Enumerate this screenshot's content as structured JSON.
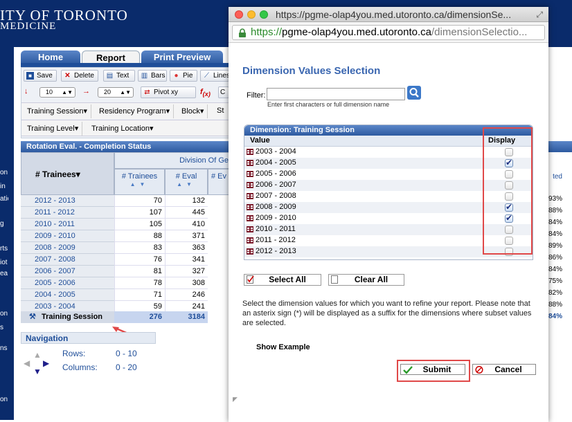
{
  "bg": {
    "uni_title": "ITY OF TORONTO",
    "uni_sub": "MEDICINE",
    "tabs": [
      {
        "label": "Home"
      },
      {
        "label": "Report"
      },
      {
        "label": "Print Preview"
      }
    ],
    "toolbar": {
      "save": "Save",
      "delete": "Delete",
      "text": "Text",
      "bars": "Bars",
      "pie": "Pie",
      "lines": "Lines",
      "rows_value": "10",
      "cols_value": "20",
      "pivot": "Pivot xy"
    },
    "dimensions": {
      "row1": [
        "Training Session",
        "Residency Program",
        "Block",
        "St"
      ],
      "row2": [
        "Training Level",
        "Training Location"
      ]
    },
    "grid": {
      "title": "Rotation Eval. - Completion Status",
      "row_header": "# Trainees",
      "division_header": "Division Of Ge",
      "col_trainees": "# Trainees",
      "col_eval": "# Eval",
      "col_ev": "# Ev",
      "rows": [
        {
          "label": "2012 - 2013",
          "trainees": "70",
          "eval": "132"
        },
        {
          "label": "2011 - 2012",
          "trainees": "107",
          "eval": "445"
        },
        {
          "label": "2010 - 2011",
          "trainees": "105",
          "eval": "410"
        },
        {
          "label": "2009 - 2010",
          "trainees": "88",
          "eval": "371"
        },
        {
          "label": "2008 - 2009",
          "trainees": "83",
          "eval": "363"
        },
        {
          "label": "2007 - 2008",
          "trainees": "76",
          "eval": "341"
        },
        {
          "label": "2006 - 2007",
          "trainees": "81",
          "eval": "327"
        },
        {
          "label": "2005 - 2006",
          "trainees": "78",
          "eval": "308"
        },
        {
          "label": "2004 - 2005",
          "trainees": "71",
          "eval": "246"
        },
        {
          "label": "2003 - 2004",
          "trainees": "59",
          "eval": "241"
        }
      ],
      "total": {
        "label": "Training Session",
        "trainees": "276",
        "eval": "3184"
      },
      "right_col": {
        "header": "ted",
        "values": [
          "93%",
          "88%",
          "84%",
          "84%",
          "89%",
          "86%",
          "84%",
          "75%",
          "82%",
          "88%",
          "84%"
        ]
      }
    },
    "navigation": {
      "title": "Navigation",
      "rows_label": "Rows:",
      "rows_range": "0  -  10",
      "cols_label": "Columns:",
      "cols_range": "0  -  20"
    }
  },
  "popup": {
    "window_title": "https://pgme-olap4you.med.utoronto.ca/dimensionSe...",
    "url_proto": "https://",
    "url_host": "pgme-olap4you.med.utoronto.ca",
    "url_path": "/dimensionSelectio...",
    "heading": "Dimension Values Selection",
    "filter_label": "Filter:",
    "filter_value": "",
    "filter_hint": "Enter first characters or full dimension name",
    "panel_title": "Dimension: Training Session",
    "col_value": "Value",
    "col_display": "Display",
    "values": [
      {
        "label": "2003 - 2004",
        "checked": false
      },
      {
        "label": "2004 - 2005",
        "checked": true
      },
      {
        "label": "2005 - 2006",
        "checked": false
      },
      {
        "label": "2006 - 2007",
        "checked": false
      },
      {
        "label": "2007 - 2008",
        "checked": false
      },
      {
        "label": "2008 - 2009",
        "checked": true
      },
      {
        "label": "2009 - 2010",
        "checked": true
      },
      {
        "label": "2010 - 2011",
        "checked": false
      },
      {
        "label": "2011 - 2012",
        "checked": false
      },
      {
        "label": "2012 - 2013",
        "checked": false
      }
    ],
    "select_all": "Select All",
    "clear_all": "Clear All",
    "info": "Select the dimension values for which you want to refine your report. Please note that an asterix sign (*) will be displayed as a suffix for the dimensions where subset values are selected.",
    "show_example": "Show Example",
    "submit": "Submit",
    "cancel": "Cancel",
    "colors": {
      "accent": "#3a66b0",
      "highlight": "#e04848",
      "header": "#2d5aa0"
    }
  }
}
